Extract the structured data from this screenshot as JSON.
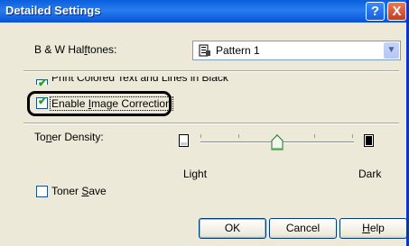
{
  "window": {
    "title": "Detailed Settings",
    "help_button": "?",
    "close_button": "X"
  },
  "halftones": {
    "label_pre": "B & W Hal",
    "label_accel": "f",
    "label_post": "tones:",
    "selected": "Pattern 1"
  },
  "print_colored_black": {
    "label": "Print Colored Text and Lines in Black",
    "checked": true
  },
  "enable_image_correction": {
    "label_pre": "Enable ",
    "label_accel": "I",
    "label_post": "mage Correction",
    "checked": true
  },
  "toner_density": {
    "label_pre": "To",
    "label_accel": "n",
    "label_post": "er Density:",
    "min_label": "Light",
    "max_label": "Dark",
    "level": 0.5
  },
  "toner_save": {
    "label_pre": "Toner ",
    "label_accel": "S",
    "label_post": "ave",
    "checked": false
  },
  "buttons": {
    "ok": "OK",
    "cancel": "Cancel",
    "help_pre": "",
    "help_accel": "H",
    "help_post": "elp"
  },
  "colors": {
    "titlebar": "#0a5fdc",
    "dialog_bg": "#ece9d8",
    "check_green": "#21a121"
  },
  "icons": {
    "select_item": "document-printer-icon",
    "light_density": "light-page-icon",
    "dark_density": "dark-page-icon",
    "slider_thumb": "slider-thumb-icon"
  }
}
